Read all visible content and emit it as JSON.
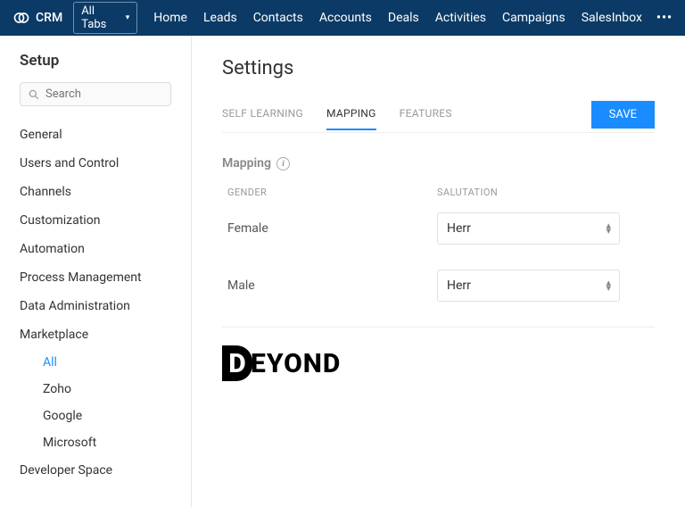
{
  "brand": "CRM",
  "alltabs_label": "All Tabs",
  "nav": [
    "Home",
    "Leads",
    "Contacts",
    "Accounts",
    "Deals",
    "Activities",
    "Campaigns",
    "SalesInbox"
  ],
  "sidebar": {
    "title": "Setup",
    "search_placeholder": "Search",
    "items": [
      "General",
      "Users and Control",
      "Channels",
      "Customization",
      "Automation",
      "Process Management",
      "Data Administration",
      "Marketplace"
    ],
    "marketplace_children": [
      "All",
      "Zoho",
      "Google",
      "Microsoft"
    ],
    "active_child": "All",
    "last_item": "Developer Space"
  },
  "content": {
    "heading": "Settings",
    "tabs": [
      "SELF LEARNING",
      "MAPPING",
      "FEATURES"
    ],
    "active_tab": "MAPPING",
    "save_label": "SAVE",
    "section_title": "Mapping",
    "columns": {
      "gender": "GENDER",
      "salutation": "SALUTATION"
    },
    "rows": [
      {
        "gender": "Female",
        "salutation": "Herr"
      },
      {
        "gender": "Male",
        "salutation": "Herr"
      }
    ],
    "footer_logo_parts": {
      "left": "D",
      "right": "EYOND"
    }
  }
}
